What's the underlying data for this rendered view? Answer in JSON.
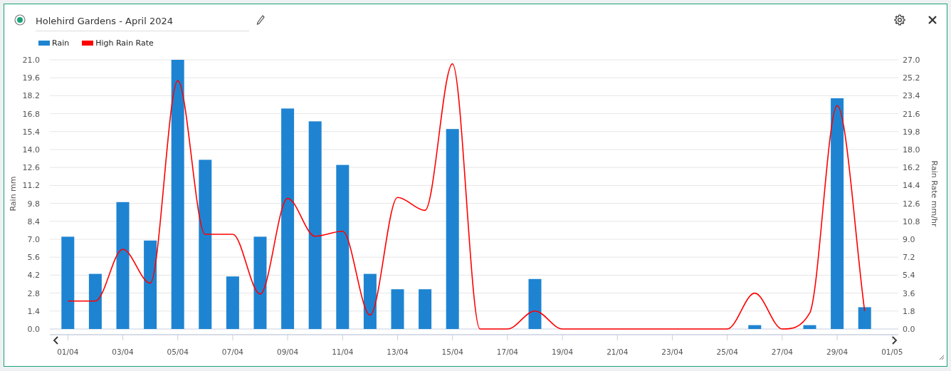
{
  "header": {
    "title": "Holehird Gardens - April 2024",
    "selected": true
  },
  "chart": {
    "chart_data": {
      "type": "bar",
      "categories": [
        "01/04",
        null,
        "03/04",
        null,
        "05/04",
        null,
        "07/04",
        null,
        "09/04",
        null,
        "11/04",
        null,
        "13/04",
        null,
        "15/04",
        null,
        "17/04",
        null,
        "19/04",
        null,
        "21/04",
        null,
        "23/04",
        null,
        "25/04",
        null,
        "27/04",
        null,
        "29/04",
        null,
        "01/05"
      ],
      "grid": true,
      "series": [
        {
          "name": "Rain",
          "color": "#1e84d2",
          "values": [
            7.2,
            4.3,
            9.9,
            6.9,
            21.0,
            13.2,
            4.1,
            7.2,
            17.2,
            16.2,
            12.8,
            4.3,
            3.1,
            3.1,
            15.6,
            0,
            0,
            3.9,
            0,
            0,
            0,
            0,
            0,
            0,
            0,
            0.3,
            0,
            0.3,
            18.0,
            1.7,
            null
          ]
        },
        {
          "name": "High Rain Rate",
          "color": "#ff0000",
          "type": "line",
          "axis": "y2",
          "values": [
            2.8,
            2.8,
            8.0,
            4.6,
            24.9,
            9.5,
            9.5,
            3.5,
            13.1,
            9.3,
            9.8,
            1.4,
            13.2,
            11.9,
            26.6,
            0,
            0,
            1.8,
            0,
            0,
            0,
            0,
            0,
            0,
            0,
            3.6,
            0,
            1.6,
            22.4,
            1.8,
            null
          ]
        }
      ],
      "ylabel": "Rain mm",
      "y2label": "Rain Rate mm/hr",
      "ylim": [
        0,
        21
      ],
      "yticks": [
        {
          "value": 0,
          "label": "0.0"
        },
        {
          "value": 1.4,
          "label": "1.4"
        },
        {
          "value": 2.8,
          "label": "2.8"
        },
        {
          "value": 4.2,
          "label": "4.2"
        },
        {
          "value": 5.6,
          "label": "5.6"
        },
        {
          "value": 7,
          "label": "7.0"
        },
        {
          "value": 8.4,
          "label": "8.4"
        },
        {
          "value": 9.8,
          "label": "9.8"
        },
        {
          "value": 11.2,
          "label": "11.2"
        },
        {
          "value": 12.6,
          "label": "12.6"
        },
        {
          "value": 14,
          "label": "14.0"
        },
        {
          "value": 15.4,
          "label": "15.4"
        },
        {
          "value": 16.8,
          "label": "16.8"
        },
        {
          "value": 18.2,
          "label": "18.2"
        },
        {
          "value": 19.6,
          "label": "19.6"
        },
        {
          "value": 21,
          "label": "21.0"
        }
      ],
      "y2lim": [
        0,
        27
      ],
      "y2ticks": [
        {
          "value": 0,
          "label": "0.0"
        },
        {
          "value": 1.8,
          "label": "1.8"
        },
        {
          "value": 3.6,
          "label": "3.6"
        },
        {
          "value": 5.4,
          "label": "5.4"
        },
        {
          "value": 7.2,
          "label": "7.2"
        },
        {
          "value": 9,
          "label": "9.0"
        },
        {
          "value": 10.8,
          "label": "10.8"
        },
        {
          "value": 12.6,
          "label": "12.6"
        },
        {
          "value": 14.4,
          "label": "14.4"
        },
        {
          "value": 16.2,
          "label": "16.2"
        },
        {
          "value": 18,
          "label": "18.0"
        },
        {
          "value": 19.8,
          "label": "19.8"
        },
        {
          "value": 21.6,
          "label": "21.6"
        },
        {
          "value": 23.4,
          "label": "23.4"
        },
        {
          "value": 25.2,
          "label": "25.2"
        },
        {
          "value": 27,
          "label": "27.0"
        }
      ]
    }
  }
}
